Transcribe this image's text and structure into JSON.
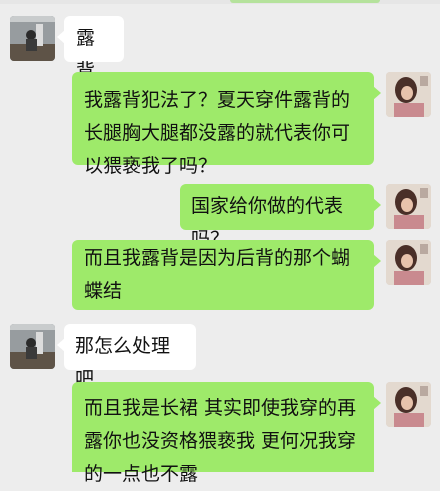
{
  "chat": {
    "messages": [
      {
        "sender": "them",
        "text": "露背"
      },
      {
        "sender": "me",
        "text": "我露背犯法了？夏天穿件露背的长腿胸大腿都没露的就代表你可以猥亵我了吗？"
      },
      {
        "sender": "me",
        "text": "国家给你做的代表吗？"
      },
      {
        "sender": "me",
        "text": "而且我露背是因为后背的那个蝴蝶结"
      },
      {
        "sender": "them",
        "text": "那怎么处理吧"
      },
      {
        "sender": "me",
        "text": "而且我是长裙 其实即使我穿的再露你也没资格猥亵我 更何况我穿的一点也不露"
      }
    ]
  },
  "colors": {
    "background": "#ededed",
    "my_bubble": "#9eea6a",
    "their_bubble": "#ffffff"
  }
}
